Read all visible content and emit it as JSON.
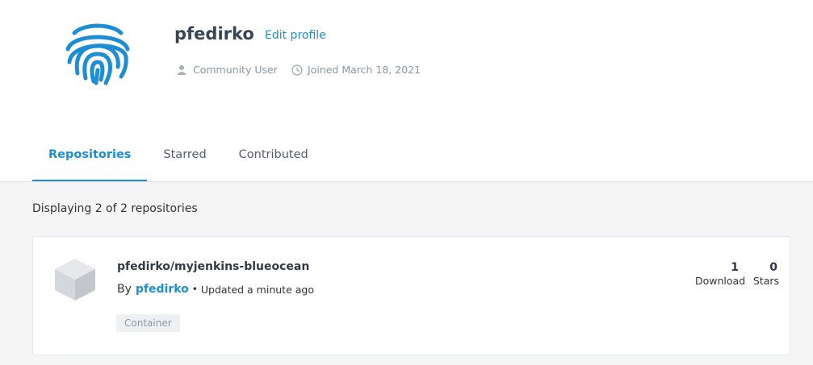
{
  "profile": {
    "username": "pfedirko",
    "edit_label": "Edit profile",
    "role": "Community User",
    "joined": "Joined March 18, 2021",
    "avatar_icon": "fingerprint-icon",
    "accent_color": "#1d8ed4"
  },
  "tabs": [
    {
      "label": "Repositories",
      "active": true
    },
    {
      "label": "Starred",
      "active": false
    },
    {
      "label": "Contributed",
      "active": false
    }
  ],
  "listing": {
    "count_text": "Displaying 2 of 2 repositories"
  },
  "repo": {
    "name": "pfedirko/myjenkins-blueocean",
    "by_label": "By",
    "owner": "pfedirko",
    "separator": "•",
    "updated": "Updated a minute ago",
    "tag": "Container",
    "downloads_value": "1",
    "downloads_label": "Download",
    "stars_value": "0",
    "stars_label": "Stars",
    "icon": "cube-icon"
  }
}
